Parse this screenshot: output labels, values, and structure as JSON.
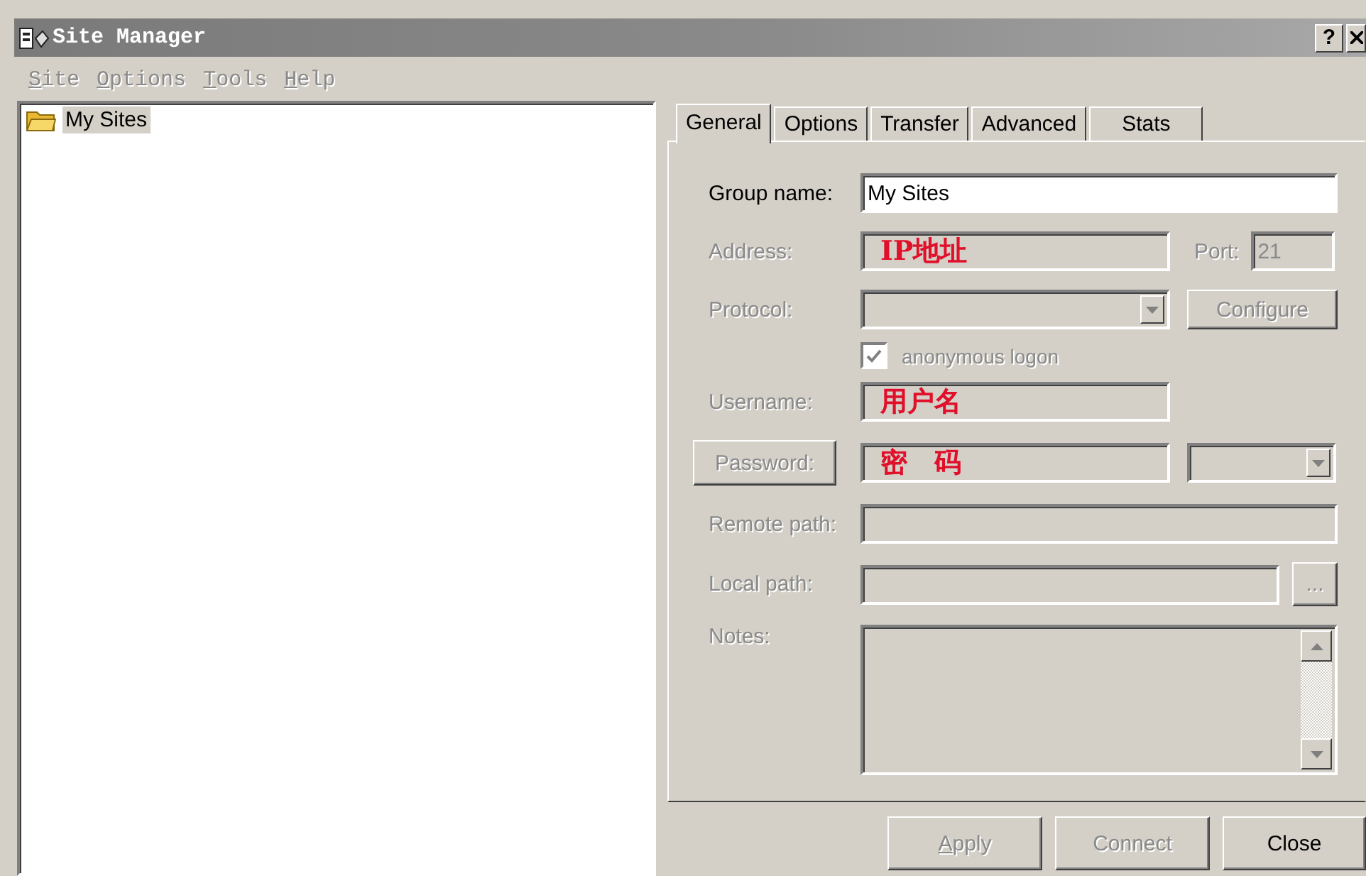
{
  "window": {
    "title": "Site Manager",
    "help": "?"
  },
  "menu": [
    {
      "label": "Site"
    },
    {
      "label": "Options"
    },
    {
      "label": "Tools"
    },
    {
      "label": "Help"
    }
  ],
  "tree": {
    "items": [
      {
        "label": "My Sites",
        "selected": true
      }
    ]
  },
  "tabs": [
    {
      "label": "General",
      "selected": true
    },
    {
      "label": "Options",
      "selected": false
    },
    {
      "label": "Transfer",
      "selected": false
    },
    {
      "label": "Advanced",
      "selected": false
    },
    {
      "label": "Stats",
      "selected": false
    }
  ],
  "form": {
    "group_name": {
      "label": "Group name:",
      "value": "My Sites",
      "disabled": false
    },
    "address": {
      "label": "Address:",
      "value": "IP地址",
      "disabled": true
    },
    "port": {
      "label": "Port:",
      "value": "21",
      "disabled": true
    },
    "protocol": {
      "label": "Protocol:",
      "disabled": true
    },
    "configure": {
      "label": "Configure",
      "disabled": true
    },
    "anonymous": {
      "label": "anonymous logon",
      "checked": true,
      "disabled": true
    },
    "username": {
      "label": "Username:",
      "value": "用户名",
      "disabled": true
    },
    "password": {
      "label": "Password:",
      "value": "密　码",
      "disabled": true
    },
    "remote_path": {
      "label": "Remote path:",
      "disabled": true
    },
    "local_path": {
      "label": "Local path:",
      "disabled": true
    },
    "browse": {
      "label": "...",
      "disabled": true
    },
    "notes": {
      "label": "Notes:",
      "disabled": true
    }
  },
  "buttons": [
    {
      "label": "Apply",
      "disabled": true,
      "mnemonic": true
    },
    {
      "label": "Connect",
      "disabled": true,
      "mnemonic": false
    },
    {
      "label": "Close",
      "disabled": false,
      "mnemonic": false
    }
  ]
}
